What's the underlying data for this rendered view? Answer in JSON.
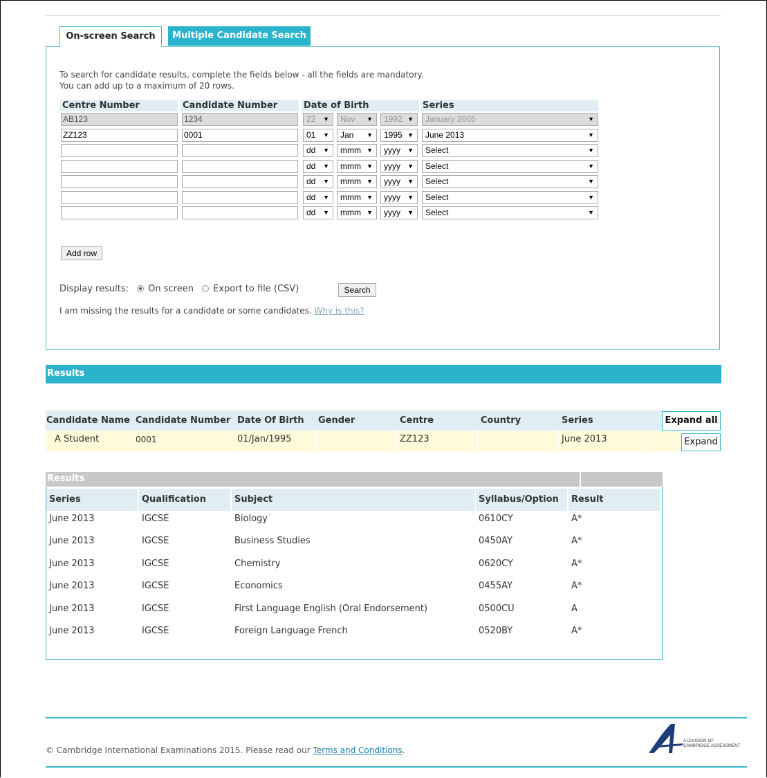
{
  "tabs": {
    "on_screen": "On-screen Search",
    "multiple": "Multiple Candidate Search"
  },
  "intro": {
    "line1": "To search for candidate results, complete the fields below - all the fields are mandatory.",
    "line2": "You can add up to a maximum of 20 rows."
  },
  "grid": {
    "headers": {
      "centre": "Centre Number",
      "candidate": "Candidate Number",
      "dob": "Date of Birth",
      "series": "Series"
    },
    "rows": [
      {
        "centre": "AB123",
        "candidate": "1234",
        "dd": "22",
        "mmm": "Nov",
        "yyyy": "1992",
        "series": "January 2005"
      },
      {
        "centre": "ZZ123",
        "candidate": "0001",
        "dd": "01",
        "mmm": "Jan",
        "yyyy": "1995",
        "series": "June 2013"
      },
      {
        "centre": "",
        "candidate": "",
        "dd": "dd",
        "mmm": "mmm",
        "yyyy": "yyyy",
        "series": "Select"
      },
      {
        "centre": "",
        "candidate": "",
        "dd": "dd",
        "mmm": "mmm",
        "yyyy": "yyyy",
        "series": "Select"
      },
      {
        "centre": "",
        "candidate": "",
        "dd": "dd",
        "mmm": "mmm",
        "yyyy": "yyyy",
        "series": "Select"
      },
      {
        "centre": "",
        "candidate": "",
        "dd": "dd",
        "mmm": "mmm",
        "yyyy": "yyyy",
        "series": "Select"
      },
      {
        "centre": "",
        "candidate": "",
        "dd": "dd",
        "mmm": "mmm",
        "yyyy": "yyyy",
        "series": "Select"
      }
    ]
  },
  "buttons": {
    "add_row": "Add row",
    "search": "Search",
    "expand_all": "Expand all",
    "expand": "Expand"
  },
  "display": {
    "label": "Display results:",
    "on_screen": "On screen",
    "export": "Export to file (CSV)"
  },
  "missing": {
    "text": "I am missing the results for a candidate or some candidates.",
    "link": "Why is this?"
  },
  "results_bar": "Results",
  "candidates": {
    "headers": [
      "Candidate Name",
      "Candidate Number",
      "Date Of Birth",
      "Gender",
      "Centre",
      "Country",
      "Series"
    ],
    "row": {
      "name": "A Student",
      "number": "0001",
      "dob": "01/Jan/1995",
      "gender": "",
      "centre": "ZZ123",
      "country": "",
      "series": "June 2013"
    }
  },
  "detail": {
    "title": "Results",
    "headers": {
      "series": "Series",
      "qualification": "Qualification",
      "subject": "Subject",
      "syllabus": "Syllabus/Option",
      "result": "Result"
    },
    "rows": [
      {
        "series": "June 2013",
        "qualification": "IGCSE",
        "subject": "Biology",
        "syllabus": "0610CY",
        "result": "A*"
      },
      {
        "series": "June 2013",
        "qualification": "IGCSE",
        "subject": "Business Studies",
        "syllabus": "0450AY",
        "result": "A*"
      },
      {
        "series": "June 2013",
        "qualification": "IGCSE",
        "subject": "Chemistry",
        "syllabus": "0620CY",
        "result": "A*"
      },
      {
        "series": "June 2013",
        "qualification": "IGCSE",
        "subject": "Economics",
        "syllabus": "0455AY",
        "result": "A*"
      },
      {
        "series": "June 2013",
        "qualification": "IGCSE",
        "subject": "First Language English (Oral Endorsement)",
        "syllabus": "0500CU",
        "result": "A"
      },
      {
        "series": "June 2013",
        "qualification": "IGCSE",
        "subject": "Foreign Language French",
        "syllabus": "0520BY",
        "result": "A*"
      }
    ]
  },
  "footer": {
    "text": "© Cambridge International Examinations 2015. Please read our",
    "link": "Terms and Conditions",
    "end": ".",
    "logo_line1": "A DIVISION OF",
    "logo_line2": "CAMBRIDGE ASSESSMENT"
  },
  "colors": {
    "accent": "#2bb3cc",
    "header_bg": "#e0eef3",
    "row_highlight": "#fdfbd9",
    "disabled": "#dcdcdc"
  }
}
